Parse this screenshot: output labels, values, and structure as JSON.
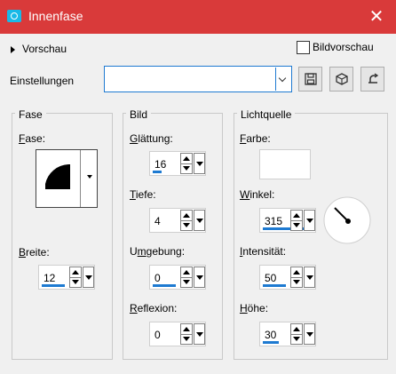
{
  "window": {
    "title": "Innenfase",
    "close_glyph": "✕"
  },
  "vorschau": {
    "label": "Vorschau"
  },
  "bildvorschau": {
    "label": "Bildvorschau",
    "checked": false
  },
  "einstellungen": {
    "label": "Einstellungen",
    "value": ""
  },
  "toolbar": {
    "icons": [
      "save-icon",
      "cube-icon",
      "reset-icon"
    ]
  },
  "fase_group": {
    "title": "Fase",
    "fase": {
      "label_u": "F",
      "label_rest": "ase:"
    },
    "breite": {
      "label_u": "B",
      "label_rest": "reite:",
      "value": "12"
    }
  },
  "bild_group": {
    "title": "Bild",
    "glaettung": {
      "label_u": "G",
      "label_rest": "lättung:",
      "value": "16"
    },
    "tiefe": {
      "label_u": "T",
      "label_rest": "iefe:",
      "value": "4"
    },
    "umgebung": {
      "label_pre": "U",
      "label_u": "m",
      "label_rest": "gebung:",
      "value": "0"
    },
    "reflexion": {
      "label_u": "R",
      "label_rest": "eflexion:",
      "value": "0"
    }
  },
  "licht_group": {
    "title": "Lichtquelle",
    "farbe": {
      "label_u": "F",
      "label_rest": "arbe:",
      "color": "#ffffff"
    },
    "winkel": {
      "label_u": "W",
      "label_rest": "inkel:",
      "value": "315"
    },
    "intensitaet": {
      "label_u": "I",
      "label_rest": "ntensität:",
      "value": "50"
    },
    "hoehe": {
      "label_u": "H",
      "label_rest": "öhe:",
      "value": "30"
    }
  },
  "colors": {
    "titlebar": "#d93a3a",
    "accent": "#1e7ad1"
  }
}
